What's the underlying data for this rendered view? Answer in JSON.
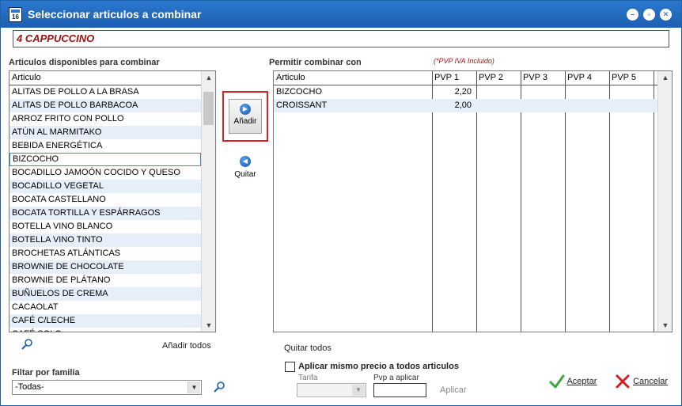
{
  "window": {
    "title": "Seleccionar articulos a combinar"
  },
  "article": {
    "value": "4  CAPPUCCINO"
  },
  "left": {
    "title": "Articulos disponibles para combinar",
    "column_header": "Articulo",
    "items": [
      "ALITAS DE POLLO A LA BRASA",
      "ALITAS DE POLLO BARBACOA",
      "ARROZ FRITO CON POLLO",
      "ATÚN AL MARMITAKO",
      "BEBIDA ENERGÉTICA",
      "BIZCOCHO",
      "BOCADILLO JAMOÓN COCIDO Y QUESO",
      "BOCADILLO VEGETAL",
      "BOCATA CASTELLANO",
      "BOCATA TORTILLA Y ESPÁRRAGOS",
      "BOTELLA VINO BLANCO",
      "BOTELLA VINO TINTO",
      "BROCHETAS ATLÁNTICAS",
      "BROWNIE DE CHOCOLATE",
      "BROWNIE DE PLÁTANO",
      "BUÑUELOS DE CREMA",
      "CACAOLAT",
      "CAFÉ C/LECHE",
      "CAFÉ SOLO"
    ],
    "selected_index": 5,
    "add_all_label": "Añadir todos"
  },
  "middle": {
    "add_label": "Añadir",
    "remove_label": "Quitar"
  },
  "right": {
    "title": "Permitir combinar con",
    "note": "(*PVP IVA Incluido)",
    "columns": [
      "Articulo",
      "PVP 1",
      "PVP 2",
      "PVP 3",
      "PVP 4",
      "PVP 5"
    ],
    "rows": [
      {
        "name": "BIZCOCHO",
        "pvp1": "2,20"
      },
      {
        "name": "CROISSANT",
        "pvp1": "2,00"
      }
    ],
    "remove_all_label": "Quitar todos"
  },
  "filter": {
    "label": "Filtar por familia",
    "value": "-Todas-"
  },
  "same_price": {
    "label": "Aplicar mismo precio a todos articulos",
    "tarifa_label": "Tarifa",
    "pvp_label": "Pvp a aplicar",
    "apply_label": "Aplicar"
  },
  "actions": {
    "accept_label": "Aceptar",
    "cancel_label": "Cancelar"
  },
  "colors": {
    "titlebar": "#1d5fb0",
    "accent_red": "#e02020",
    "row_alt": "#e6eefa"
  }
}
